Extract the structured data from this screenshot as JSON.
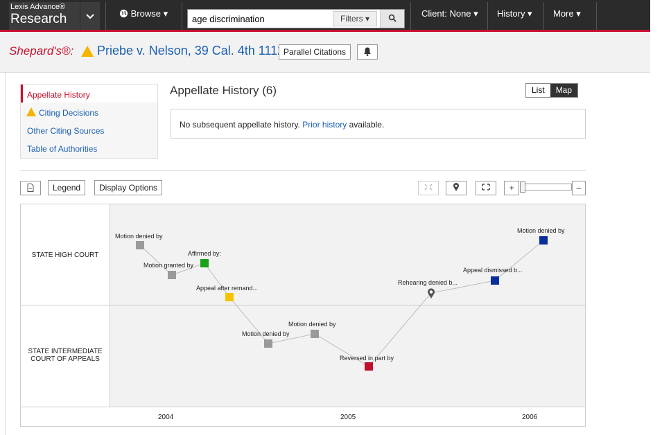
{
  "header": {
    "brand_line1": "Lexis Advance®",
    "brand_line2": "Research",
    "brand_chevron": "⌄",
    "browse_label": "Browse ▾",
    "search_value": "age discrimination",
    "filters_label": "Filters ▾",
    "client_label": "Client: None ▾",
    "history_label": "History ▾",
    "more_label": "More ▾",
    "browse_icon": "globe-icon",
    "search_icon": "magnifier-icon"
  },
  "shepards": {
    "label": "Shepard's®:",
    "signal": "caution",
    "case_title": "Priebe v. Nelson, 39 Cal. 4th 1112",
    "parallel_label": "Parallel Citations",
    "bell_icon": "bell-icon"
  },
  "sidebar": {
    "items": [
      {
        "label": "Appellate History",
        "active": true
      },
      {
        "label": "Citing Decisions",
        "icon": "warning-triangle-icon"
      },
      {
        "label": "Other Citing Sources"
      },
      {
        "label": "Table of Authorities"
      }
    ]
  },
  "main": {
    "title": "Appellate History (6)",
    "view_toggle": {
      "list": "List",
      "map": "Map",
      "selected": "Map"
    },
    "message_prefix": "No subsequent appellate history.",
    "message_link": "Prior history",
    "message_suffix": "available."
  },
  "toolbar": {
    "export_icon": "document-export-icon",
    "legend_label": "Legend",
    "display_options_label": "Display Options",
    "fit_icon": "shrink-icon",
    "pin_icon": "map-pin-icon",
    "expand_icon": "expand-icon",
    "zoom_in": "+",
    "zoom_out": "–"
  },
  "map": {
    "lanes": [
      "STATE HIGH COURT",
      "STATE INTERMEDIATE COURT OF APPEALS"
    ],
    "years": [
      "2004",
      "2005",
      "2006"
    ],
    "nodes": [
      {
        "label": "Motion denied by",
        "color": "#9a9a9a"
      },
      {
        "label": "Motion granted by",
        "color": "#9a9a9a"
      },
      {
        "label": "Affirmed by:",
        "color": "#1aa01a"
      },
      {
        "label": "Appeal after remand...",
        "color": "#f5c400"
      },
      {
        "label": "Motion denied by",
        "color": "#9a9a9a"
      },
      {
        "label": "Motion denied by",
        "color": "#9a9a9a"
      },
      {
        "label": "Reversed in part by",
        "color": "#c0102e"
      },
      {
        "label": "Rehearing denied b...",
        "color": "#555555"
      },
      {
        "label": "Appeal dismissed b...",
        "color": "#0a2f9a"
      },
      {
        "label": "Motion denied by",
        "color": "#0a2f9a"
      }
    ]
  }
}
